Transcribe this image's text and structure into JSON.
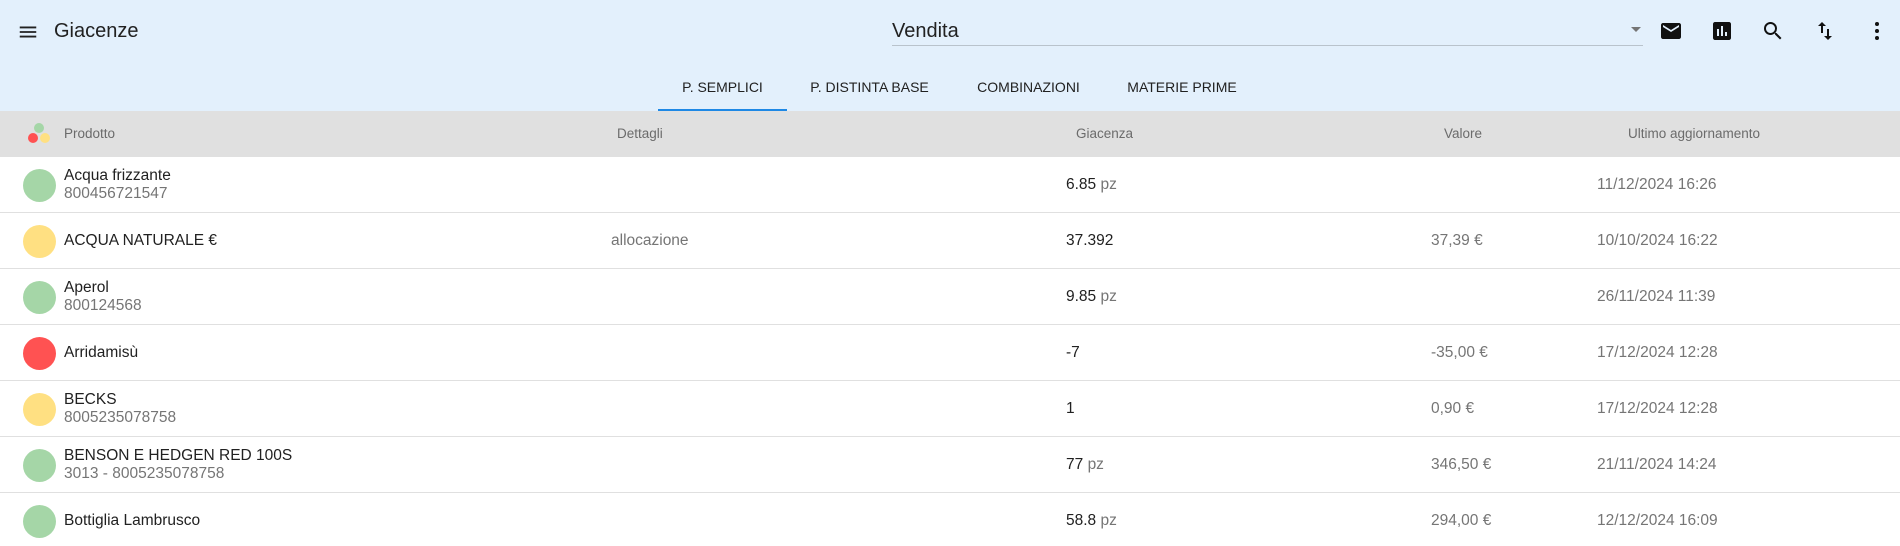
{
  "app": {
    "title": "Giacenze"
  },
  "select": {
    "value": "Vendita"
  },
  "toolbar": [
    "mail-icon",
    "chart-icon",
    "search-icon",
    "sort-icon",
    "more-vert-icon"
  ],
  "tabs": [
    {
      "label": "P. SEMPLICI",
      "active": true
    },
    {
      "label": "P. DISTINTA BASE",
      "active": false
    },
    {
      "label": "COMBINAZIONI",
      "active": false
    },
    {
      "label": "MATERIE PRIME",
      "active": false
    }
  ],
  "columns": {
    "product": "Prodotto",
    "details": "Dettagli",
    "stock": "Giacenza",
    "value": "Valore",
    "updated": "Ultimo aggiornamento"
  },
  "colors": {
    "green": "#a5d6a7",
    "yellow": "#ffe082",
    "red": "#ff5252",
    "accent": "#1e88e5"
  },
  "rows": [
    {
      "status": "green",
      "name": "Acqua frizzante",
      "code": "800456721547",
      "details": "",
      "qty": "6.85",
      "unit": "pz",
      "value": "",
      "updated": "11/12/2024 16:26"
    },
    {
      "status": "yellow",
      "name": "ACQUA NATURALE €",
      "code": "",
      "details": "allocazione",
      "qty": "37.392",
      "unit": "",
      "value": "37,39 €",
      "updated": "10/10/2024 16:22"
    },
    {
      "status": "green",
      "name": "Aperol",
      "code": "800124568",
      "details": "",
      "qty": "9.85",
      "unit": "pz",
      "value": "",
      "updated": "26/11/2024 11:39"
    },
    {
      "status": "red",
      "name": "Arridamisù",
      "code": "",
      "details": "",
      "qty": "-7",
      "unit": "",
      "value": "-35,00 €",
      "updated": "17/12/2024 12:28"
    },
    {
      "status": "yellow",
      "name": "BECKS",
      "code": "8005235078758",
      "details": "",
      "qty": "1",
      "unit": "",
      "value": "0,90 €",
      "updated": "17/12/2024 12:28"
    },
    {
      "status": "green",
      "name": "BENSON E HEDGEN RED 100S",
      "code": "3013 - 8005235078758",
      "details": "",
      "qty": "77",
      "unit": "pz",
      "value": "346,50 €",
      "updated": "21/11/2024 14:24"
    },
    {
      "status": "green",
      "name": "Bottiglia Lambrusco",
      "code": "",
      "details": "",
      "qty": "58.8",
      "unit": "pz",
      "value": "294,00 €",
      "updated": "12/12/2024 16:09"
    }
  ]
}
